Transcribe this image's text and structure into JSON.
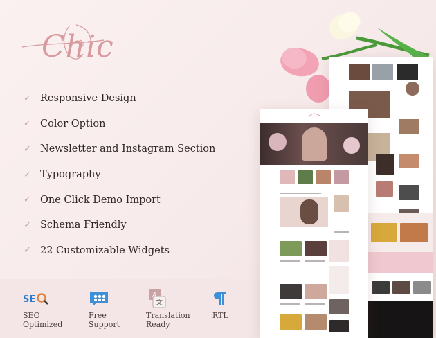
{
  "brand": {
    "logo_text": "Chic",
    "accent_color": "#d89a9f"
  },
  "features": [
    "Responsive Design",
    "Color Option",
    "Newsletter and Instagram Section",
    "Typography",
    "One Click Demo Import",
    "Schema Friendly",
    "22 Customizable Widgets"
  ],
  "badges": [
    {
      "icon": "seo-search-icon",
      "line1": "SEO",
      "line2": "Optimized"
    },
    {
      "icon": "chat-support-icon",
      "line1": "Free",
      "line2": "Support"
    },
    {
      "icon": "translation-icon",
      "line1": "Translation",
      "line2": "Ready"
    },
    {
      "icon": "pilcrow-rtl-icon",
      "line1": "RTL",
      "line2": ""
    }
  ]
}
